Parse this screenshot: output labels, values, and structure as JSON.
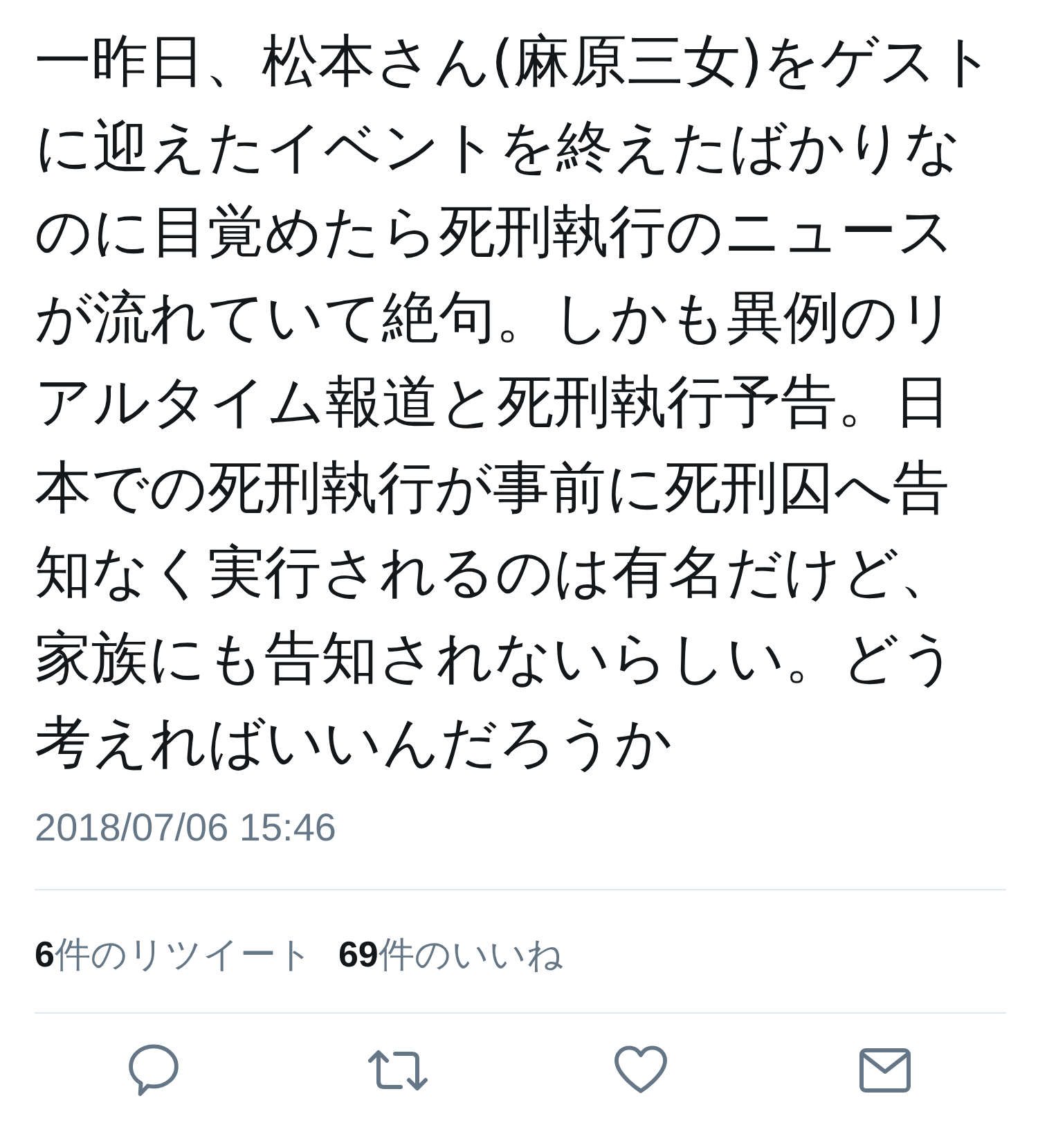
{
  "tweet": {
    "text": "一昨日、松本さん(麻原三女)をゲストに迎えたイベントを終えたばかりなのに目覚めたら死刑執行のニュースが流れていて絶句。しかも異例のリアルタイム報道と死刑執行予告。日本での死刑執行が事前に死刑囚へ告知なく実行されるのは有名だけど、家族にも告知されないらしい。どう考えればいいんだろうか",
    "timestamp": "2018/07/06 15:46"
  },
  "stats": [
    "**6**件のリツイート",
    "**69**件のいいね"
  ],
  "actions": [
    {
      "kind": "reply"
    },
    {
      "kind": "retweet"
    },
    {
      "kind": "like"
    },
    {
      "kind": "message"
    }
  ]
}
